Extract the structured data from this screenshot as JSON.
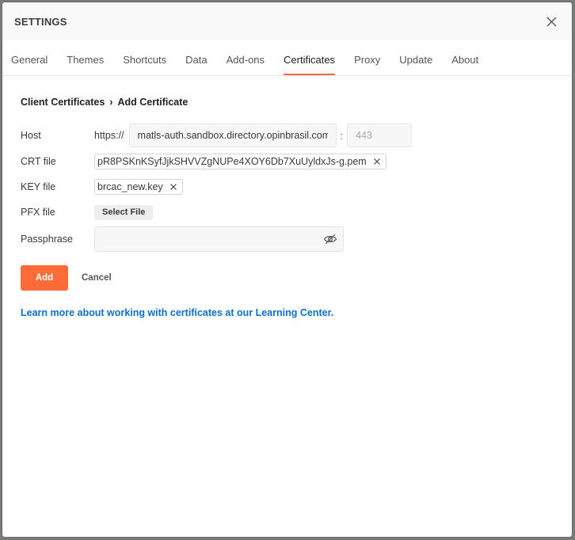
{
  "header": {
    "title": "SETTINGS"
  },
  "tabs": [
    {
      "label": "General"
    },
    {
      "label": "Themes"
    },
    {
      "label": "Shortcuts"
    },
    {
      "label": "Data"
    },
    {
      "label": "Add-ons"
    },
    {
      "label": "Certificates",
      "active": true
    },
    {
      "label": "Proxy"
    },
    {
      "label": "Update"
    },
    {
      "label": "About"
    }
  ],
  "breadcrumb": {
    "parent": "Client Certificates",
    "separator": "›",
    "current": "Add Certificate"
  },
  "form": {
    "host_label": "Host",
    "host_prefix": "https://",
    "host_value": "matls-auth.sandbox.directory.opinbrasil.com.br",
    "port_placeholder": "443",
    "crt_label": "CRT file",
    "crt_file": "pR8PSKnKSyfJjkSHVVZgNUPe4XOY6Db7XuUyldxJs-g.pem",
    "key_label": "KEY file",
    "key_file": "brcac_new.key",
    "pfx_label": "PFX file",
    "pfx_button": "Select File",
    "passphrase_label": "Passphrase",
    "passphrase_value": ""
  },
  "actions": {
    "add_label": "Add",
    "cancel_label": "Cancel"
  },
  "learn_link": "Learn more about working with certificates at our Learning Center.",
  "colors": {
    "accent": "#ff6c37",
    "link": "#0b6fcf"
  }
}
